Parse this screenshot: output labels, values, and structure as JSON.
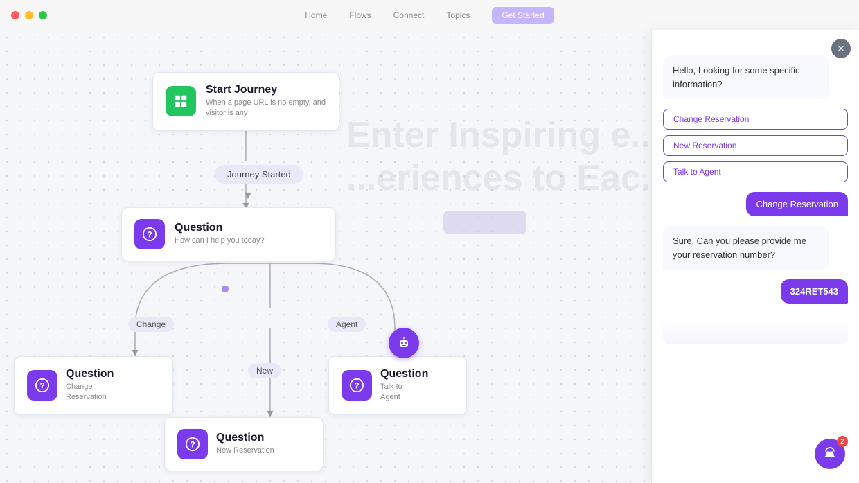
{
  "titlebar": {
    "dots": [
      "red",
      "yellow",
      "green"
    ]
  },
  "nav": {
    "items": [
      "Home",
      "Flows",
      "Connect",
      "Topics"
    ],
    "cta": "Get Started"
  },
  "watermark": {
    "line1": "Enter Inspiring e...",
    "line2": "...eriences to Eac..."
  },
  "flow": {
    "start_node": {
      "title": "Start Journey",
      "subtitle": "When a page URL is no empty, and visitor is any"
    },
    "journey_started": "Journey Started",
    "question_main": {
      "title": "Question",
      "subtitle": "How can I help you today?"
    },
    "branches": {
      "change": "Change",
      "new": "New",
      "agent": "Agent"
    },
    "node_change": {
      "title": "Question",
      "subtitle_line1": "Change",
      "subtitle_line2": "Reservation"
    },
    "node_new_res": {
      "title": "Question",
      "subtitle": "New Reservation"
    },
    "node_talk": {
      "title": "Question",
      "subtitle_line1": "Talk to",
      "subtitle_line2": "Agent"
    }
  },
  "chat": {
    "bot_greeting": "Hello, Looking for some specific information?",
    "options": [
      "Change Reservation",
      "New Reservation",
      "Talk to Agent"
    ],
    "user_selected": "Change Reservation",
    "bot_reply": "Sure. Can you please provide me your reservation number?",
    "user_code": "324RET543",
    "notification_count": "2"
  }
}
